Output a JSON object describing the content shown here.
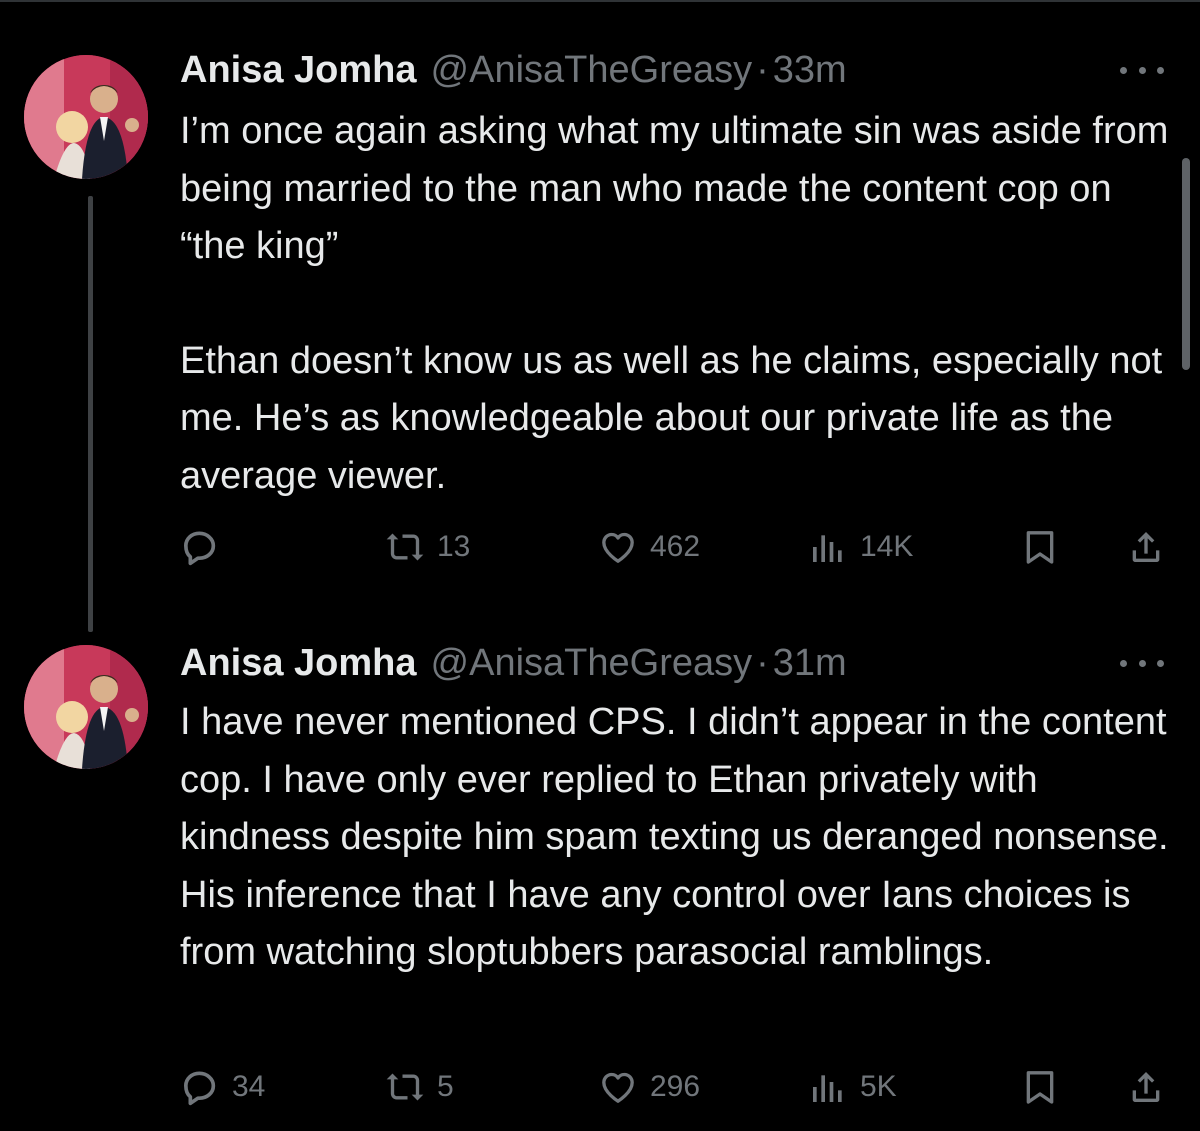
{
  "tweets": [
    {
      "name": "Anisa Jomha",
      "handle": "@AnisaTheGreasy",
      "separator": "·",
      "time": "33m",
      "paragraphs": [
        "I’m once again asking what my ultimate sin was aside from being married to the man who made the content cop on “the king”",
        "Ethan doesn’t know us as well as he claims, especially not me. He’s as knowledgeable about our private life as the average viewer."
      ],
      "replies": "",
      "retweets": "13",
      "likes": "462",
      "views": "14K"
    },
    {
      "name": "Anisa Jomha",
      "handle": "@AnisaTheGreasy",
      "separator": "·",
      "time": "31m",
      "paragraphs": [
        "I have never mentioned CPS. I didn’t appear in the content cop. I have only ever replied to Ethan privately with kindness despite him spam texting us deranged nonsense. His inference that I have any control over Ians choices is from watching sloptubbers parasocial ramblings."
      ],
      "replies": "34",
      "retweets": "5",
      "likes": "296",
      "views": "5K"
    }
  ],
  "icons": {
    "reply": "reply-icon",
    "retweet": "retweet-icon",
    "like": "heart-icon",
    "views": "views-icon",
    "bookmark": "bookmark-icon",
    "share": "share-icon",
    "more": "more-icon"
  },
  "colors": {
    "background": "#000000",
    "text": "#e7e9ea",
    "muted": "#71767b",
    "thread_line": "#3e4144"
  }
}
